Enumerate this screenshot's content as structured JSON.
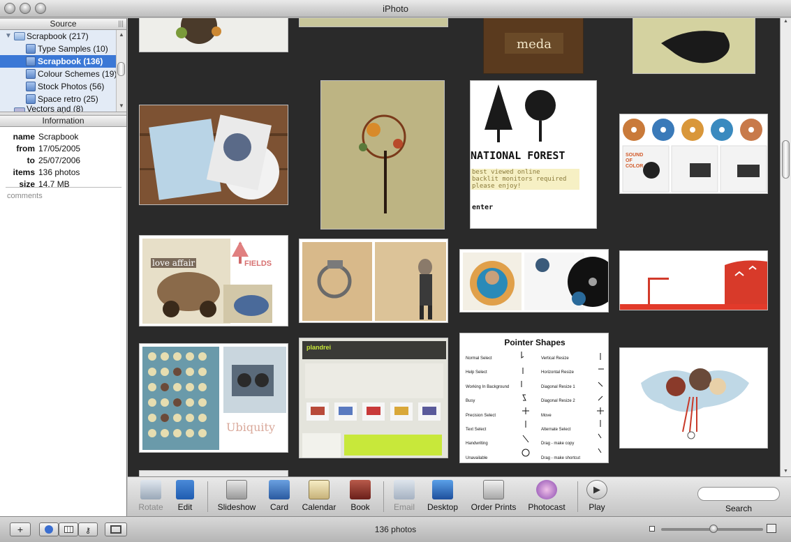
{
  "window": {
    "title": "iPhoto"
  },
  "source": {
    "header": "Source",
    "items": [
      {
        "label": "Scrapbook (217)",
        "kind": "folder"
      },
      {
        "label": "Type Samples (10)",
        "kind": "album"
      },
      {
        "label": "Scrapbook (136)",
        "kind": "album",
        "selected": true
      },
      {
        "label": "Colour Schemes (19)",
        "kind": "album"
      },
      {
        "label": "Stock Photos (56)",
        "kind": "album"
      },
      {
        "label": "Space retro (25)",
        "kind": "album"
      },
      {
        "label": "Vectors and (8)",
        "kind": "album"
      }
    ]
  },
  "information": {
    "header": "Information",
    "rows": [
      {
        "key": "name",
        "value": "Scrapbook"
      },
      {
        "key": "from",
        "value": "17/05/2005"
      },
      {
        "key": "to",
        "value": "25/07/2006"
      },
      {
        "key": "items",
        "value": "136 photos"
      },
      {
        "key": "size",
        "value": "14.7 MB"
      }
    ],
    "comments_placeholder": "comments"
  },
  "thumbnails": {
    "national_forest": {
      "title": "NATIONAL FOREST",
      "lines": [
        "best viewed online",
        "backlit monitors required",
        "please enjoy!"
      ],
      "enter": "enter"
    },
    "love_affair": {
      "title": "love affair",
      "fields": "FIELDS"
    },
    "sound_of_color": {
      "title": "SOUND OF COLOR"
    },
    "ubiquity": {
      "title": "Ubiquity"
    },
    "pointer_shapes": {
      "title": "Pointer Shapes",
      "left": [
        "Normal Select",
        "Help Select",
        "Working In Background",
        "Busy",
        "Precision Select",
        "Text Select",
        "Handwriting",
        "Unavailable"
      ],
      "right": [
        "Vertical Resize",
        "Horizontal Resize",
        "Diagonal Resize 1",
        "Diagonal Resize 2",
        "Move",
        "Alternate Select",
        "Drag - make copy",
        "Drag - make shortcut"
      ]
    },
    "plandrei": {
      "title": "plandrei"
    },
    "meda": {
      "title": "meda"
    }
  },
  "toolbar": {
    "buttons": [
      {
        "label": "Rotate",
        "icon": "rotate-icon",
        "enabled": false
      },
      {
        "label": "Edit",
        "icon": "edit-icon",
        "enabled": true
      },
      {
        "label": "Slideshow",
        "icon": "slideshow-icon",
        "enabled": true
      },
      {
        "label": "Card",
        "icon": "card-icon",
        "enabled": true
      },
      {
        "label": "Calendar",
        "icon": "calendar-icon",
        "enabled": true
      },
      {
        "label": "Book",
        "icon": "book-icon",
        "enabled": true
      },
      {
        "label": "Email",
        "icon": "email-icon",
        "enabled": false
      },
      {
        "label": "Desktop",
        "icon": "desktop-icon",
        "enabled": true
      },
      {
        "label": "Order Prints",
        "icon": "order-prints-icon",
        "enabled": true
      },
      {
        "label": "Photocast",
        "icon": "photocast-icon",
        "enabled": true
      },
      {
        "label": "Play",
        "icon": "play-icon",
        "enabled": true
      }
    ],
    "search_label": "Search"
  },
  "bottombar": {
    "status": "136 photos",
    "add_symbol": "+"
  }
}
